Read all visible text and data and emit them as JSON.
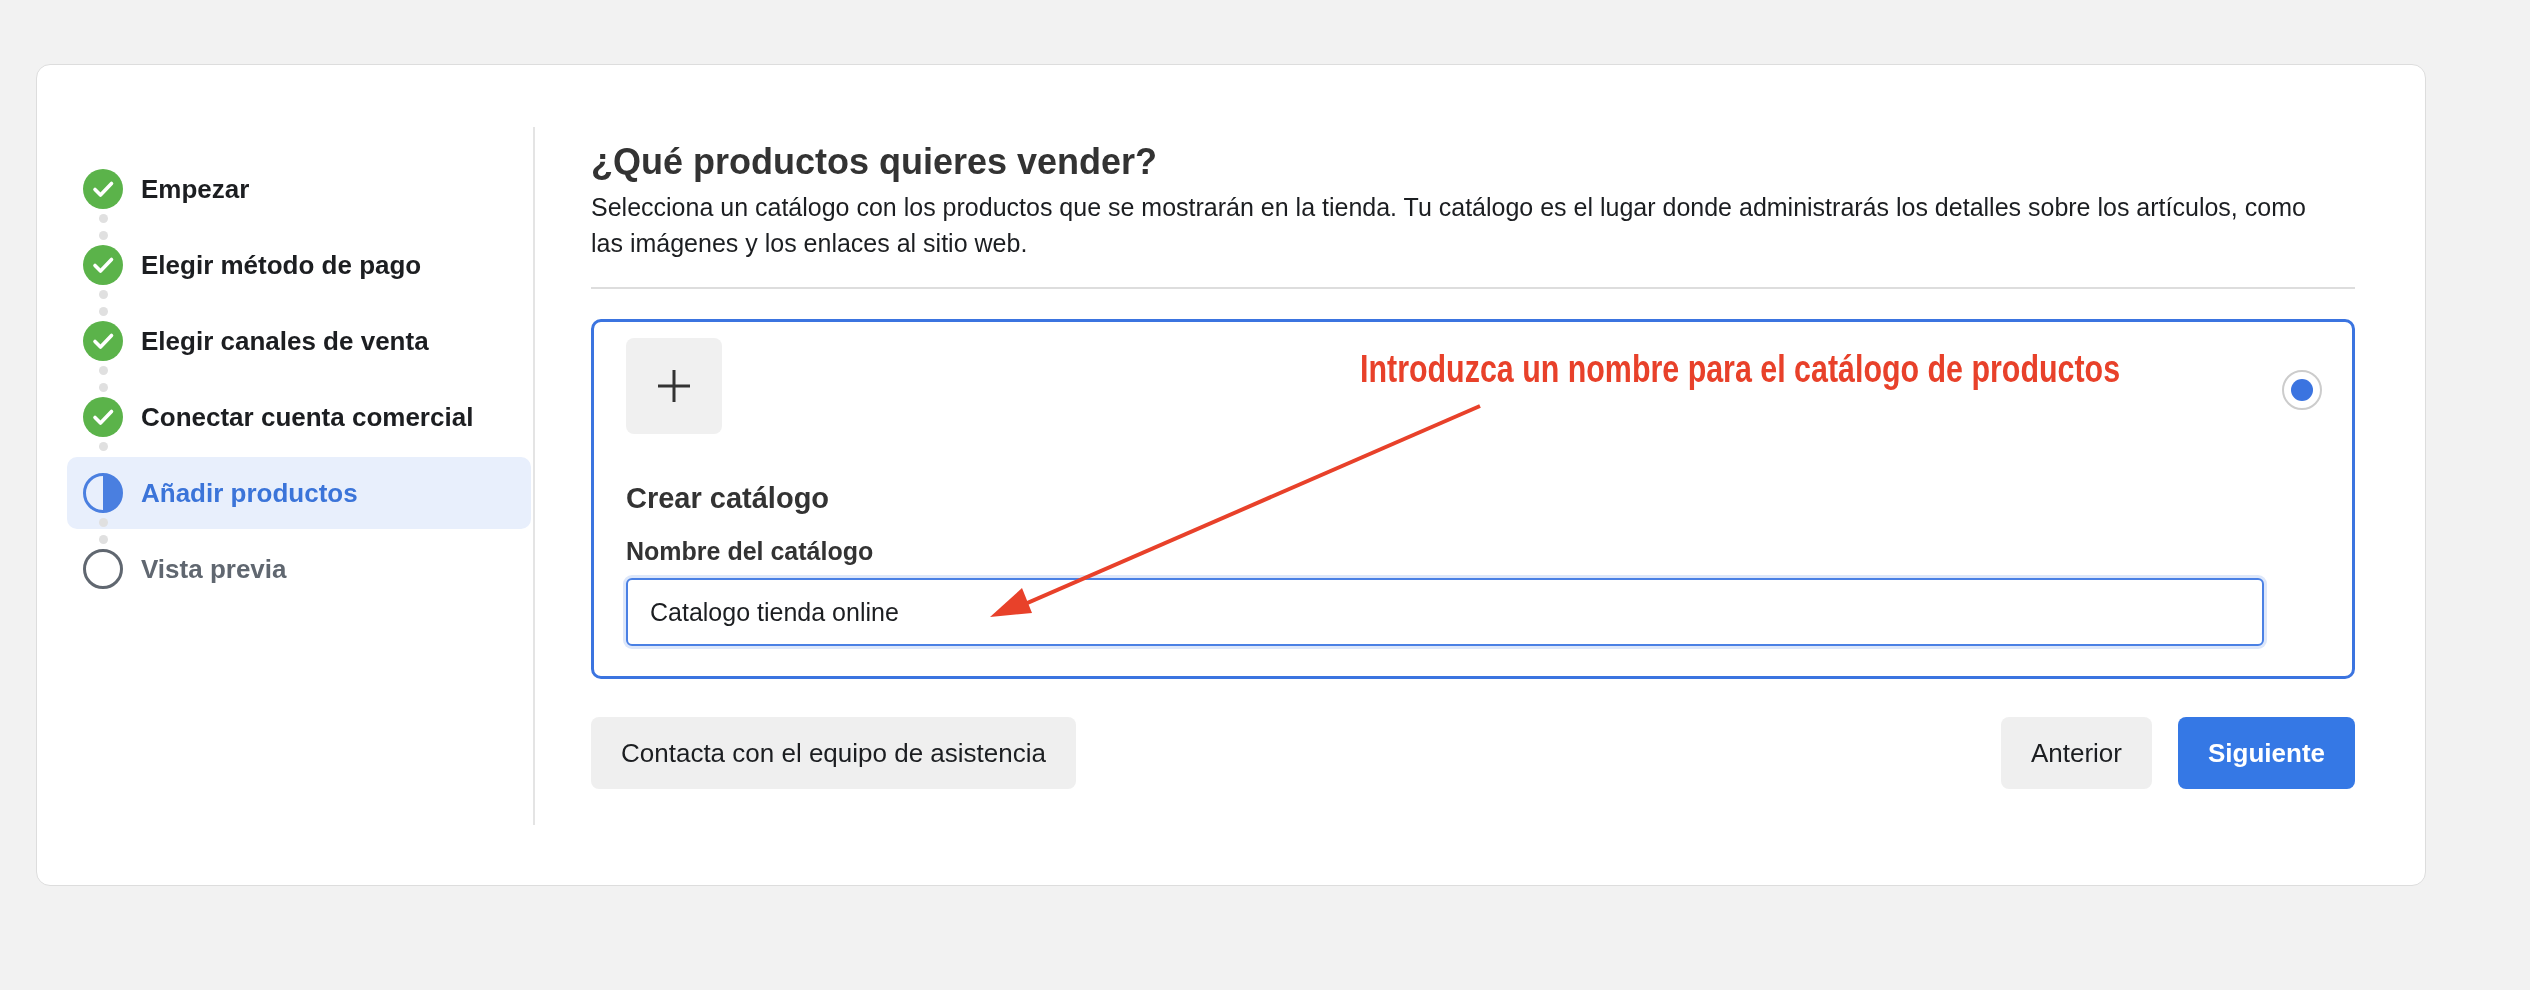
{
  "steps": [
    {
      "label": "Empezar",
      "completed": true,
      "selected": false
    },
    {
      "label": "Elegir método de pago",
      "completed": true,
      "selected": false
    },
    {
      "label": "Elegir canales de venta",
      "completed": true,
      "selected": false
    },
    {
      "label": "Conectar cuenta comercial",
      "completed": true,
      "selected": false
    },
    {
      "label": "Añadir productos",
      "completed": false,
      "selected": true
    },
    {
      "label": "Vista previa",
      "completed": false,
      "selected": false
    }
  ],
  "heading": "¿Qué productos quieres vender?",
  "description": "Selecciona un catálogo con los productos que se mostrarán en la tienda. Tu catálogo es el lugar donde administrarás los detalles sobre los artículos, como las imágenes y los enlaces al sitio web.",
  "option": {
    "selected": true,
    "title": "Crear catálogo",
    "field_label": "Nombre del catálogo",
    "field_value": "Catalogo tienda online"
  },
  "annotation": "Introduzca un nombre para el catálogo de productos",
  "buttons": {
    "support": "Contacta con el equipo de asistencia",
    "back": "Anterior",
    "next": "Siguiente"
  }
}
